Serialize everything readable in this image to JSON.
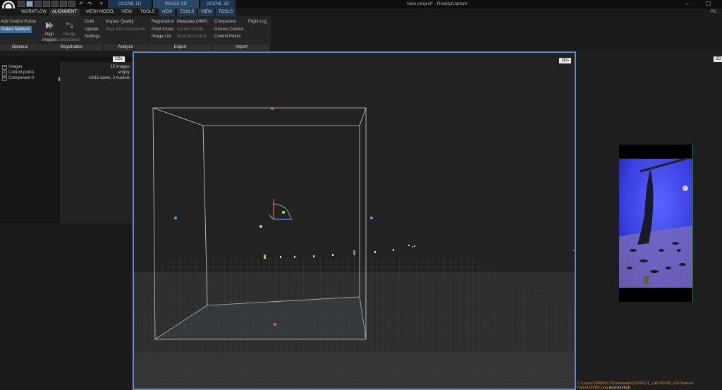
{
  "titlebar": {
    "app_title": "New project* - RealityCapture",
    "scene_tabs": [
      "SCENE 1D",
      "IMAGE 2D",
      "SCENE 3D"
    ],
    "minimize": "–",
    "maximize": "☐",
    "user_badge": "RC"
  },
  "tabs": [
    "WORKFLOW",
    "ALIGNMENT",
    "MESH MODEL",
    "VIEW",
    "TOOLS",
    "VIEW",
    "TOOLS",
    "VIEW",
    "TOOLS"
  ],
  "ribbon": {
    "optional": {
      "add_control_points": "Add Control Points",
      "detect_markers": "Detect Markers"
    },
    "registration": {
      "align": "Align",
      "align2": "Images",
      "merge": "Merge",
      "merge2": "Components",
      "draft": "Draft",
      "update": "Update",
      "settings": "Settings"
    },
    "analyze": {
      "inspect_quality": "Inspect Quality",
      "realtime_assistance": "Real-time Assistance"
    },
    "export": {
      "registration": "Registration",
      "point_cloud": "Point Cloud",
      "image_list": "Image List",
      "metadata": "Metadata (XMP)",
      "control_points": "Control Points",
      "ground_control": "Ground Control"
    },
    "import": {
      "component": "Component",
      "ground_control": "Ground Control",
      "control_points": "Control Points",
      "flight_log": "Flight Log"
    },
    "groups": [
      "Optional",
      "Registration",
      "Analyze",
      "Export",
      "Import"
    ]
  },
  "left_panel": {
    "view_badge": "1Ds",
    "tree": [
      "Images",
      "Control points",
      "Component 0"
    ],
    "info": [
      "15 images",
      "empty",
      "14/15 cams, 3 models"
    ]
  },
  "viewport": {
    "badge": "3Ds"
  },
  "right_panel": {
    "badge": "2D",
    "path_line1": "C:\\Users\\23006617\\Downloads\\20240221_145745000_iOS frames\\",
    "path_line2": "frame000000.png",
    "path_tag": "[undistorted]"
  },
  "colors": {
    "accent": "#5a8fd0",
    "highlight": "#3d6f9e",
    "path_text": "#d08a3a"
  }
}
